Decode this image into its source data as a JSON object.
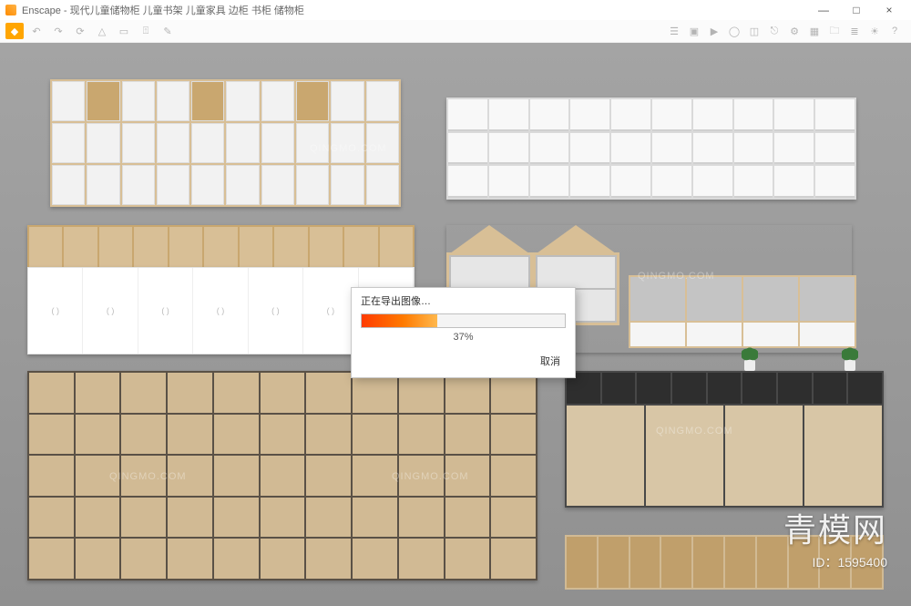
{
  "window": {
    "app_name": "Enscape",
    "title_suffix": "现代儿童储物柜 儿童书架 儿童家具 边柜 书柜 储物柜",
    "minimize": "—",
    "maximize": "□",
    "close": "×"
  },
  "toolbar": {
    "icons": [
      "home",
      "undo",
      "redo",
      "sync",
      "model",
      "folder",
      "export",
      "edit",
      "settings",
      "screenshot",
      "video",
      "panorama",
      "vr",
      "link",
      "gear",
      "grid",
      "screenshots",
      "presets",
      "sun",
      "help"
    ],
    "help_glyph": "?"
  },
  "dialog": {
    "title": "正在导出图像…",
    "percent_label": "37%",
    "percent_value": 37,
    "cancel_label": "取消"
  },
  "overlay": {
    "brand": "青模网",
    "id_prefix": "ID：",
    "id_value": "1595400",
    "watermark": "QINGMO.COM"
  },
  "cell_label": "( )"
}
